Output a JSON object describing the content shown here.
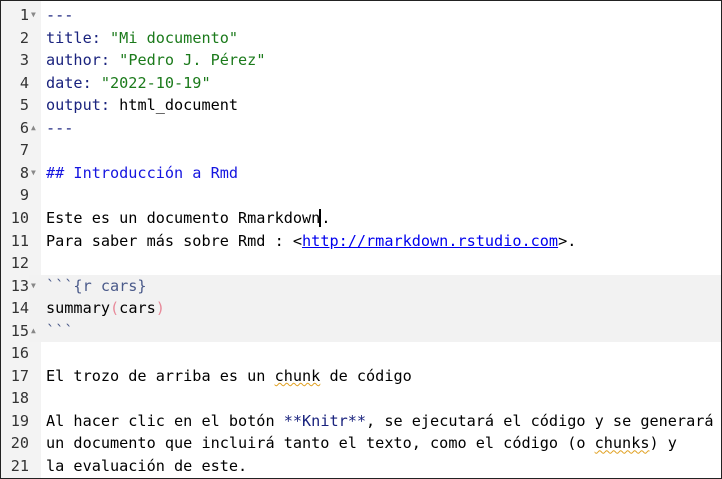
{
  "editor": {
    "lines": [
      {
        "n": "1",
        "fold": "down",
        "tokens": [
          {
            "t": "---",
            "c": "yaml-dash"
          }
        ]
      },
      {
        "n": "2",
        "tokens": [
          {
            "t": "title:",
            "c": "yaml-key"
          },
          {
            "t": " "
          },
          {
            "t": "\"Mi documento\"",
            "c": "yaml-str"
          }
        ]
      },
      {
        "n": "3",
        "tokens": [
          {
            "t": "author:",
            "c": "yaml-key"
          },
          {
            "t": " "
          },
          {
            "t": "\"Pedro J. Pérez\"",
            "c": "yaml-str"
          }
        ]
      },
      {
        "n": "4",
        "tokens": [
          {
            "t": "date:",
            "c": "yaml-key"
          },
          {
            "t": " "
          },
          {
            "t": "\"2022-10-19\"",
            "c": "yaml-str"
          }
        ]
      },
      {
        "n": "5",
        "tokens": [
          {
            "t": "output:",
            "c": "yaml-key"
          },
          {
            "t": " html_document"
          }
        ]
      },
      {
        "n": "6",
        "fold": "up",
        "tokens": [
          {
            "t": "---",
            "c": "yaml-dash"
          }
        ]
      },
      {
        "n": "7",
        "tokens": []
      },
      {
        "n": "8",
        "fold": "down",
        "tokens": [
          {
            "t": "## Introducción a Rmd",
            "c": "heading"
          }
        ]
      },
      {
        "n": "9",
        "tokens": []
      },
      {
        "n": "10",
        "tokens": [
          {
            "t": "Este es un documento Rmarkdown"
          },
          {
            "t": ".",
            "c": "cursor"
          }
        ]
      },
      {
        "n": "11",
        "tokens": [
          {
            "t": "Para saber más sobre Rmd : <"
          },
          {
            "t": "http://rmarkdown.rstudio.com",
            "c": "link"
          },
          {
            "t": ">."
          }
        ]
      },
      {
        "n": "12",
        "tokens": []
      },
      {
        "n": "13",
        "fold": "down",
        "chunk": true,
        "tokens": [
          {
            "t": "```{r cars}",
            "c": "chunk-head"
          }
        ]
      },
      {
        "n": "14",
        "chunk": true,
        "tokens": [
          {
            "t": "summary"
          },
          {
            "t": "(",
            "c": "paren"
          },
          {
            "t": "cars"
          },
          {
            "t": ")",
            "c": "paren"
          }
        ]
      },
      {
        "n": "15",
        "fold": "up",
        "chunk": true,
        "tokens": [
          {
            "t": "```",
            "c": "chunk-head"
          }
        ]
      },
      {
        "n": "16",
        "tokens": []
      },
      {
        "n": "17",
        "tokens": [
          {
            "t": "El trozo de arriba es un "
          },
          {
            "t": "chunk",
            "c": "spell"
          },
          {
            "t": " de código"
          }
        ]
      },
      {
        "n": "18",
        "tokens": []
      },
      {
        "n": "19",
        "tokens": [
          {
            "t": "Al hacer clic en el botón "
          },
          {
            "t": "**Knitr**",
            "c": "bold"
          },
          {
            "t": ", se ejecutará el código y se generará"
          }
        ]
      },
      {
        "n": "20",
        "tokens": [
          {
            "t": "un documento que incluirá tanto el texto, como el código (o "
          },
          {
            "t": "chunks",
            "c": "spell"
          },
          {
            "t": ") y"
          }
        ]
      },
      {
        "n": "21",
        "tokens": [
          {
            "t": "la evaluación de este."
          }
        ]
      }
    ]
  }
}
